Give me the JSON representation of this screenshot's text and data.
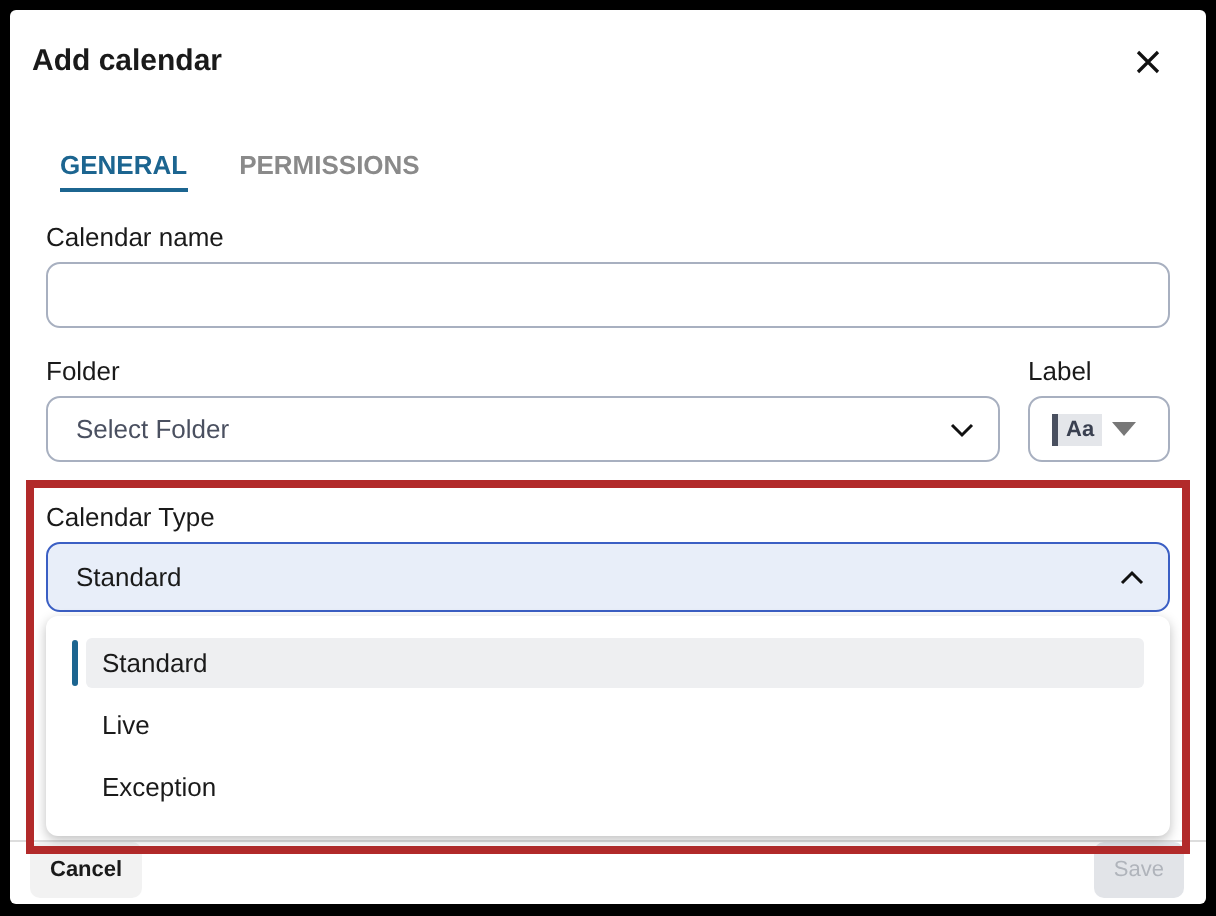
{
  "dialog": {
    "title": "Add calendar"
  },
  "tabs": [
    {
      "label": "GENERAL",
      "selected": true
    },
    {
      "label": "PERMISSIONS",
      "selected": false
    }
  ],
  "calendar_name": {
    "label": "Calendar name"
  },
  "folder": {
    "label": "Folder",
    "placeholder": "Select Folder"
  },
  "label_picker": {
    "label": "Label",
    "swatch": "Aa"
  },
  "calendar_type": {
    "label": "Calendar Type",
    "value": "Standard",
    "expanded": true,
    "options": [
      {
        "label": "Standard",
        "selected": true
      },
      {
        "label": "Live",
        "selected": false
      },
      {
        "label": "Exception",
        "selected": false
      }
    ]
  },
  "buttons": [
    {
      "label": "Cancel",
      "disabled": false
    },
    {
      "label": "Save",
      "disabled": true
    }
  ]
}
